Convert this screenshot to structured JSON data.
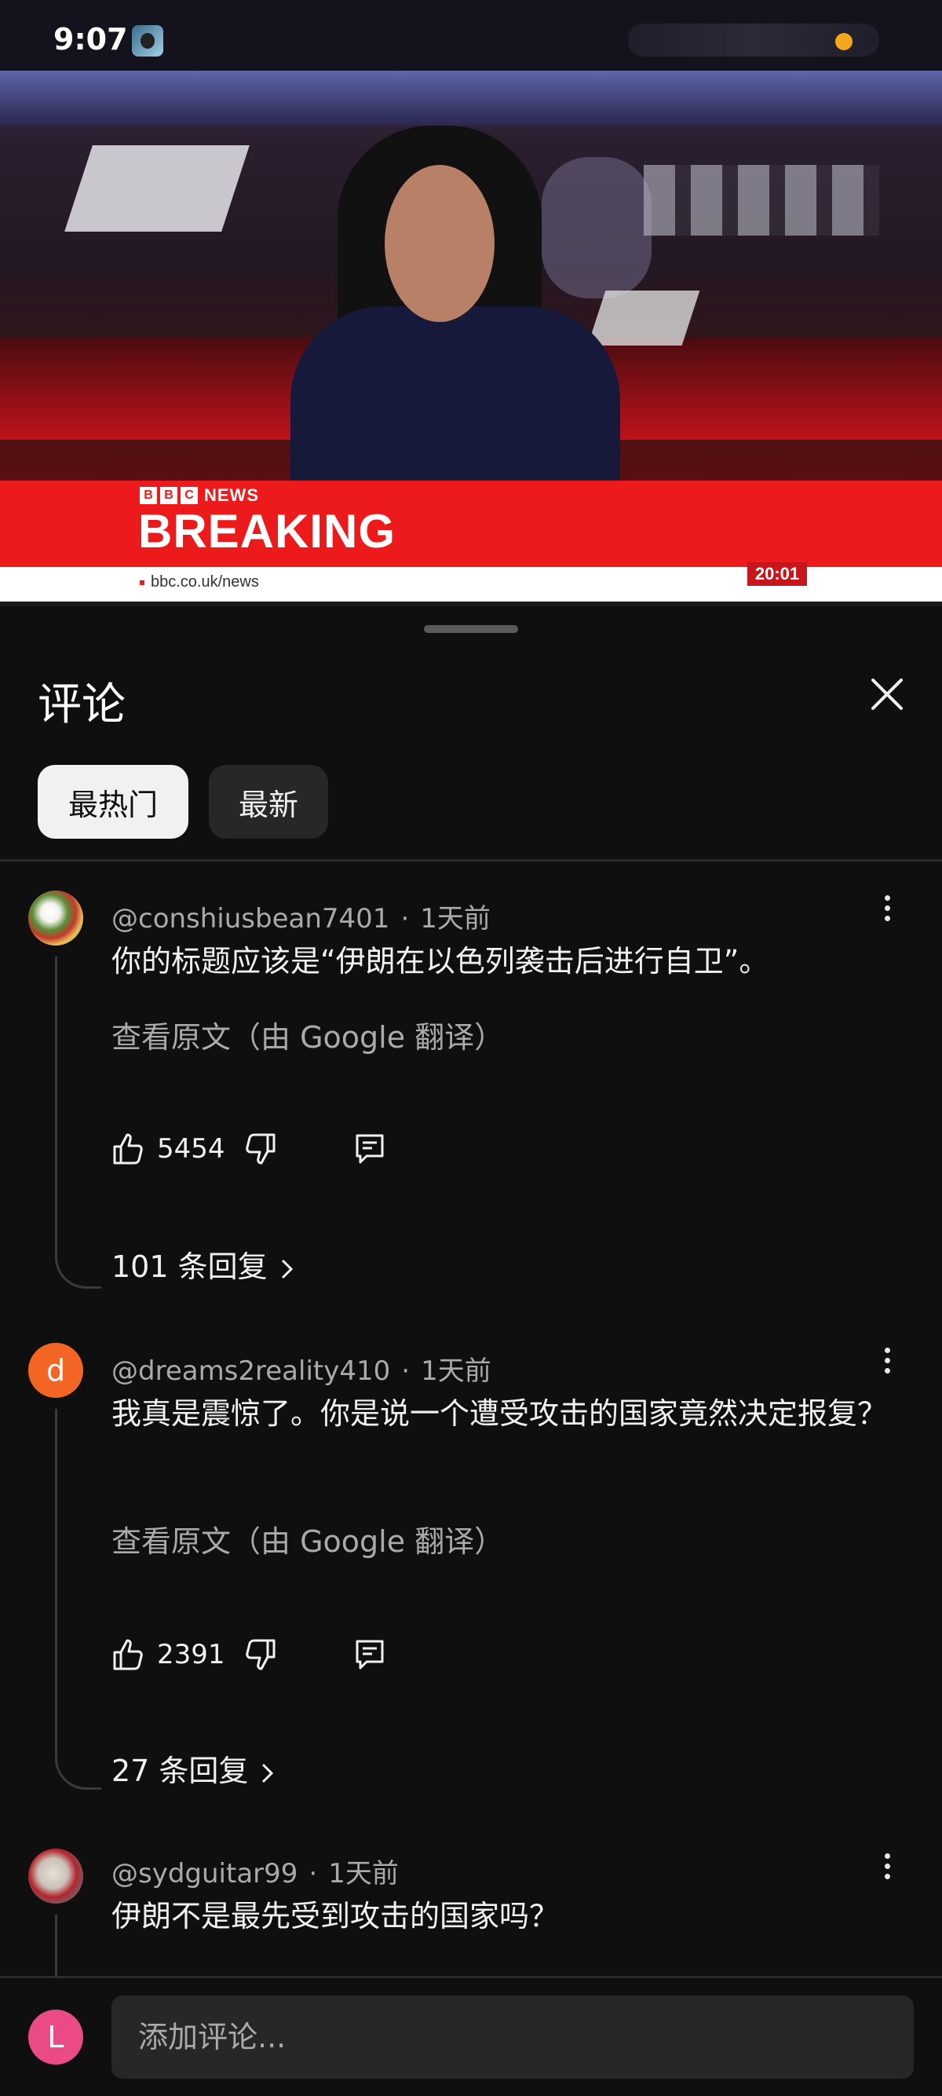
{
  "status_bar": {
    "time": "9:07"
  },
  "video": {
    "brand": "NEWS",
    "brand_letters": [
      "B",
      "B",
      "C"
    ],
    "headline": "BREAKING",
    "url": "bbc.co.uk/news",
    "clock": "20:01"
  },
  "sheet": {
    "title": "评论",
    "filters": [
      "最热门",
      "最新"
    ]
  },
  "comments": [
    {
      "author": "@conshiusbean7401",
      "time": "1天前",
      "text": "你的标题应该是“伊朗在以色列袭击后进行自卫”。",
      "translate_label": "查看原文（由 Google 翻译）",
      "likes": "5454",
      "replies": "101 条回复"
    },
    {
      "author": "@dreams2reality410",
      "avatar_letter": "d",
      "time": "1天前",
      "text": "我真是震惊了。你是说一个遭受攻击的国家竟然决定报复？",
      "translate_label": "查看原文（由 Google 翻译）",
      "likes": "2391",
      "replies": "27 条回复"
    },
    {
      "author": "@sydguitar99",
      "time": "1天前",
      "text": "伊朗不是最先受到攻击的国家吗？"
    }
  ],
  "composer": {
    "avatar_letter": "L",
    "placeholder": "添加评论..."
  }
}
